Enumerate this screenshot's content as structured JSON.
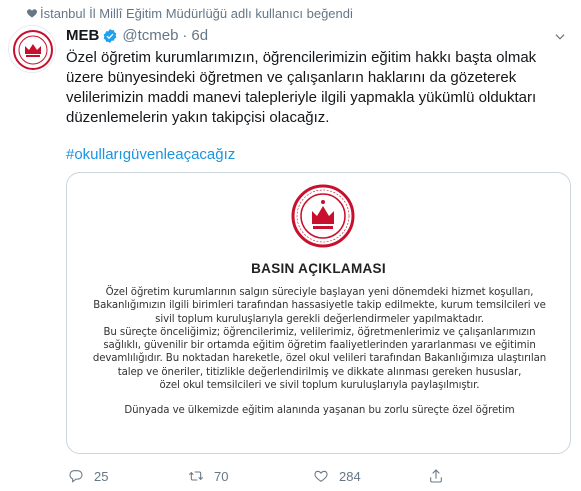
{
  "context": {
    "text": "İstanbul İl Millî Eğitim Müdürlüğü adlı kullanıcı beğendi"
  },
  "tweet": {
    "name": "MEB",
    "handle": "@tcmeb",
    "separator": "·",
    "time": "6d",
    "text": "Özel öğretim kurumlarımızın, öğrencilerimizin eğitim hakkı başta olmak üzere bünyesindeki öğretmen ve çalışanların haklarını da gözeterek velilerimizin maddi manevi talepleriyle ilgili yapmakla yükümlü olduktarı düzenlemelerin yakın takipçisi olacağız.",
    "hashtag": "#okullarıgüvenleaçacağız"
  },
  "media": {
    "title": "BASIN AÇIKLAMASI",
    "lines": [
      "Özel öğretim kurumlarının salgın süreciyle başlayan yeni dönemdeki hizmet koşulları,",
      "Bakanlığımızın ilgili birimleri tarafından hassasiyetle takip edilmekte, kurum temsilcileri ve",
      "sivil toplum kuruluşlarıyla gerekli değerlendirmeler yapılmaktadır.",
      "Bu süreçte önceliğimiz; öğrencilerimiz, velilerimiz, öğretmenlerimiz ve çalışanlarımızın",
      "sağlıklı, güvenilir bir ortamda eğitim öğretim faaliyetlerinden yararlanması ve eğitimin",
      "devamlılığıdır. Bu noktadan hareketle, özel okul velileri tarafından Bakanlığımıza ulaştırılan",
      "talep ve öneriler, titizlikle değerlendirilmiş ve dikkate alınması gereken hususlar,",
      "özel okul temsilcileri ve sivil toplum kuruluşlarıyla paylaşılmıştır."
    ],
    "last_line": "Dünyada ve ülkemizde eğitim alanında yaşanan bu zorlu süreçte özel öğretim"
  },
  "actions": {
    "reply_count": "25",
    "retweet_count": "70",
    "like_count": "284"
  },
  "icons": {
    "context": "heart-icon",
    "verified": "verified-badge-icon",
    "more": "chevron-down-icon",
    "reply": "reply-icon",
    "retweet": "retweet-icon",
    "like": "like-icon",
    "share": "share-icon"
  },
  "colors": {
    "accent": "#1b95e0",
    "muted": "#657786",
    "seal_red": "#c8102e"
  }
}
